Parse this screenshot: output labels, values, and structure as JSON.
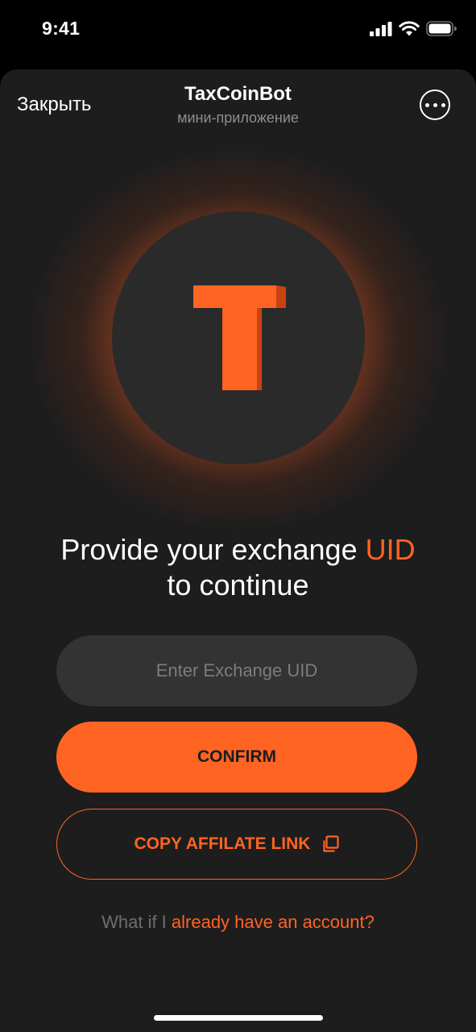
{
  "status_bar": {
    "time": "9:41"
  },
  "header": {
    "close_label": "Закрыть",
    "title": "TaxCoinBot",
    "subtitle": "мини-приложение"
  },
  "headline": {
    "part1": "Provide your exchange ",
    "accent": "UID",
    "part2": "to continue"
  },
  "uid_input": {
    "placeholder": "Enter Exchange UID",
    "value": ""
  },
  "confirm_button": {
    "label": "CONFIRM"
  },
  "affiliate_button": {
    "label": "COPY AFFILATE LINK"
  },
  "account_link": {
    "prefix": "What if I ",
    "link": "already have an account?"
  },
  "icons": {
    "close": "close-text",
    "more": "more-dots-icon",
    "copy": "copy-icon",
    "logo": "taxcoin-t-logo"
  },
  "colors": {
    "accent": "#ff6422",
    "background": "#1d1d1e",
    "input_bg": "#333333"
  }
}
